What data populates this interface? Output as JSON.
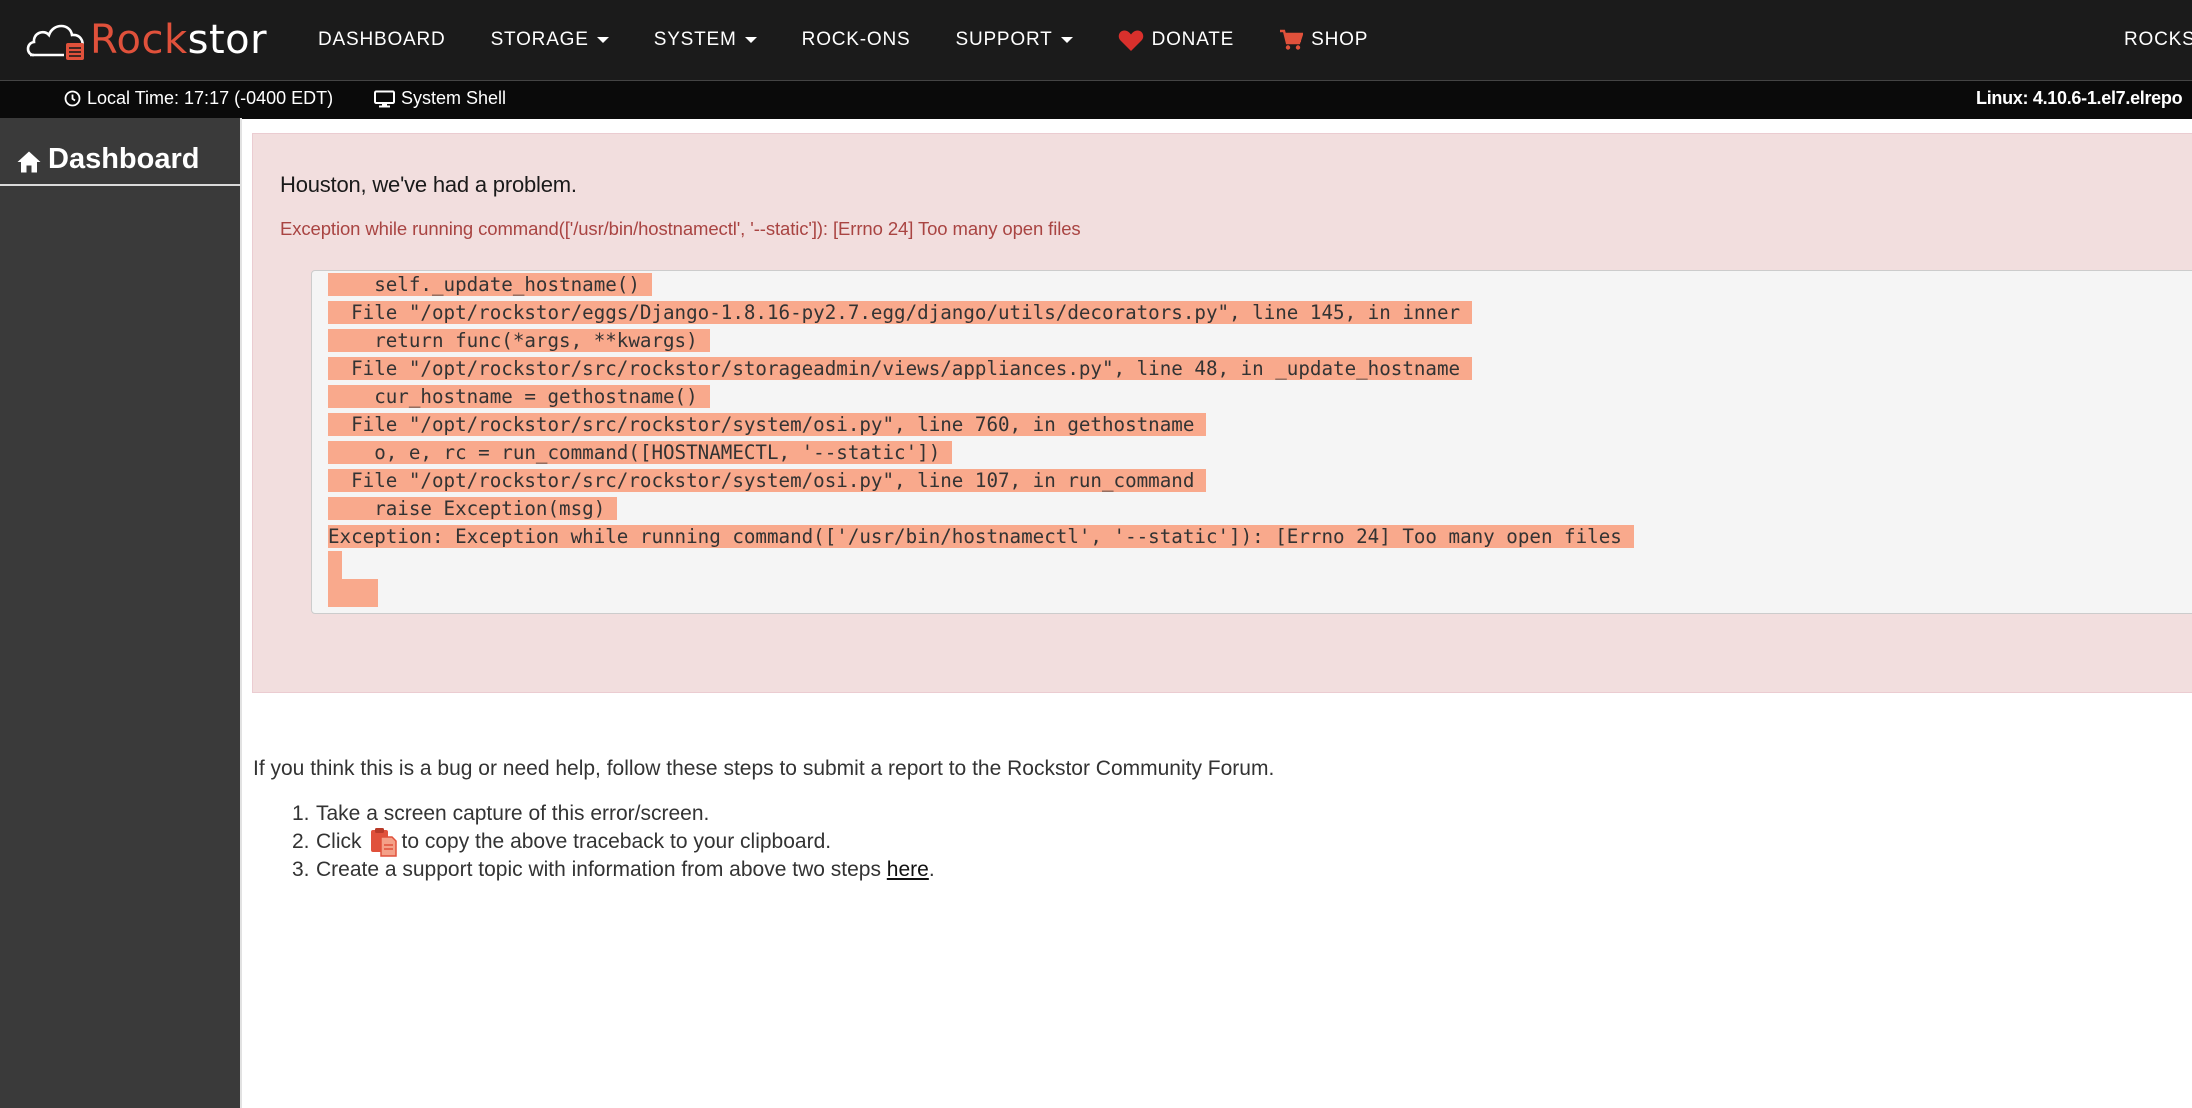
{
  "brand": {
    "name_part1": "Rock",
    "name_part2": "stor"
  },
  "nav": {
    "items": [
      {
        "label": "DASHBOARD",
        "dropdown": false
      },
      {
        "label": "STORAGE",
        "dropdown": true
      },
      {
        "label": "SYSTEM",
        "dropdown": true
      },
      {
        "label": "ROCK-ONS",
        "dropdown": false
      },
      {
        "label": "SUPPORT",
        "dropdown": true
      },
      {
        "label": "DONATE",
        "icon": "heart-icon"
      },
      {
        "label": "SHOP",
        "icon": "cart-icon"
      }
    ],
    "right_label": "ROCKSTOR"
  },
  "status_bar": {
    "local_time": "Local Time: 17:17 (-0400 EDT)",
    "system_shell": "System Shell",
    "kernel": "Linux: 4.10.6-1.el7.elrepo"
  },
  "sidebar": {
    "items": [
      {
        "label": "Dashboard",
        "icon": "home-icon"
      }
    ]
  },
  "error": {
    "title": "Houston, we've had a problem.",
    "message": "Exception while running command(['/usr/bin/hostnamectl', '--static']): [Errno 24] Too many open files",
    "traceback": [
      "    self._update_hostname()",
      "  File \"/opt/rockstor/eggs/Django-1.8.16-py2.7.egg/django/utils/decorators.py\", line 145, in inner",
      "    return func(*args, **kwargs)",
      "  File \"/opt/rockstor/src/rockstor/storageadmin/views/appliances.py\", line 48, in _update_hostname",
      "    cur_hostname = gethostname()",
      "  File \"/opt/rockstor/src/rockstor/system/osi.py\", line 760, in gethostname",
      "    o, e, rc = run_command([HOSTNAMECTL, '--static'])",
      "  File \"/opt/rockstor/src/rockstor/system/osi.py\", line 107, in run_command",
      "    raise Exception(msg)",
      "Exception: Exception while running command(['/usr/bin/hostnamectl', '--static']): [Errno 24] Too many open files"
    ]
  },
  "help": {
    "intro": "If you think this is a bug or need help, follow these steps to submit a report to the Rockstor Community Forum.",
    "step1": "Take a screen capture of this error/screen.",
    "step2_before": "Click",
    "step2_after": "to copy the above traceback to your clipboard.",
    "step3_before": "Create a support topic with information from above two steps",
    "step3_link": "here",
    "step3_after": "."
  },
  "colors": {
    "navbar_bg": "#1b1b1b",
    "brand_accent": "#e0513b",
    "sidebar_bg": "#3a3a3a",
    "alert_bg": "#f2dede",
    "alert_text": "#a94442",
    "traceback_highlight": "#f9a98c"
  }
}
